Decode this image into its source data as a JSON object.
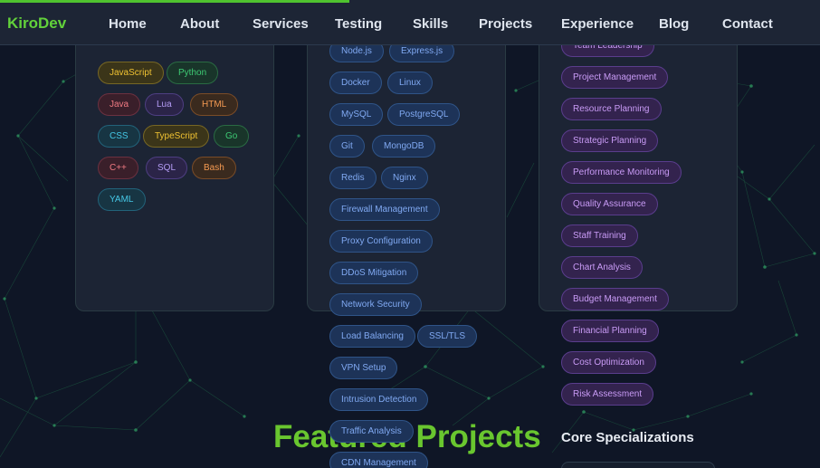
{
  "nav": {
    "brand": "KiroDev",
    "links": [
      "Home",
      "About",
      "Services",
      "Testing",
      "Skills",
      "Projects",
      "Experience",
      "Blog",
      "Contact"
    ]
  },
  "skills": {
    "languages": [
      "JavaScript",
      "Python",
      "Java",
      "Lua",
      "HTML",
      "CSS",
      "TypeScript",
      "Go",
      "C++",
      "SQL",
      "Bash",
      "YAML"
    ],
    "tools": [
      "Node.js",
      "Express.js",
      "Docker",
      "Linux",
      "MySQL",
      "PostgreSQL",
      "Git",
      "MongoDB",
      "Redis",
      "Nginx",
      "Firewall Management",
      "Proxy Configuration",
      "DDoS Mitigation",
      "Network Security",
      "Load Balancing",
      "SSL/TLS",
      "VPN Setup",
      "Intrusion Detection",
      "Traffic Analysis",
      "CDN Management"
    ],
    "management": [
      "Team Leadership",
      "Project Management",
      "Resource Planning",
      "Strategic Planning",
      "Performance Monitoring",
      "Quality Assurance",
      "Staff Training",
      "Chart Analysis",
      "Budget Management",
      "Financial Planning",
      "Cost Optimization",
      "Risk Assessment"
    ]
  },
  "sections": {
    "featured_title": "Featured Projects",
    "core_title": "Core Specializations"
  },
  "colors": {
    "accent": "#69c62f",
    "background": "#0f1626",
    "nav_background": "#1d2535"
  }
}
